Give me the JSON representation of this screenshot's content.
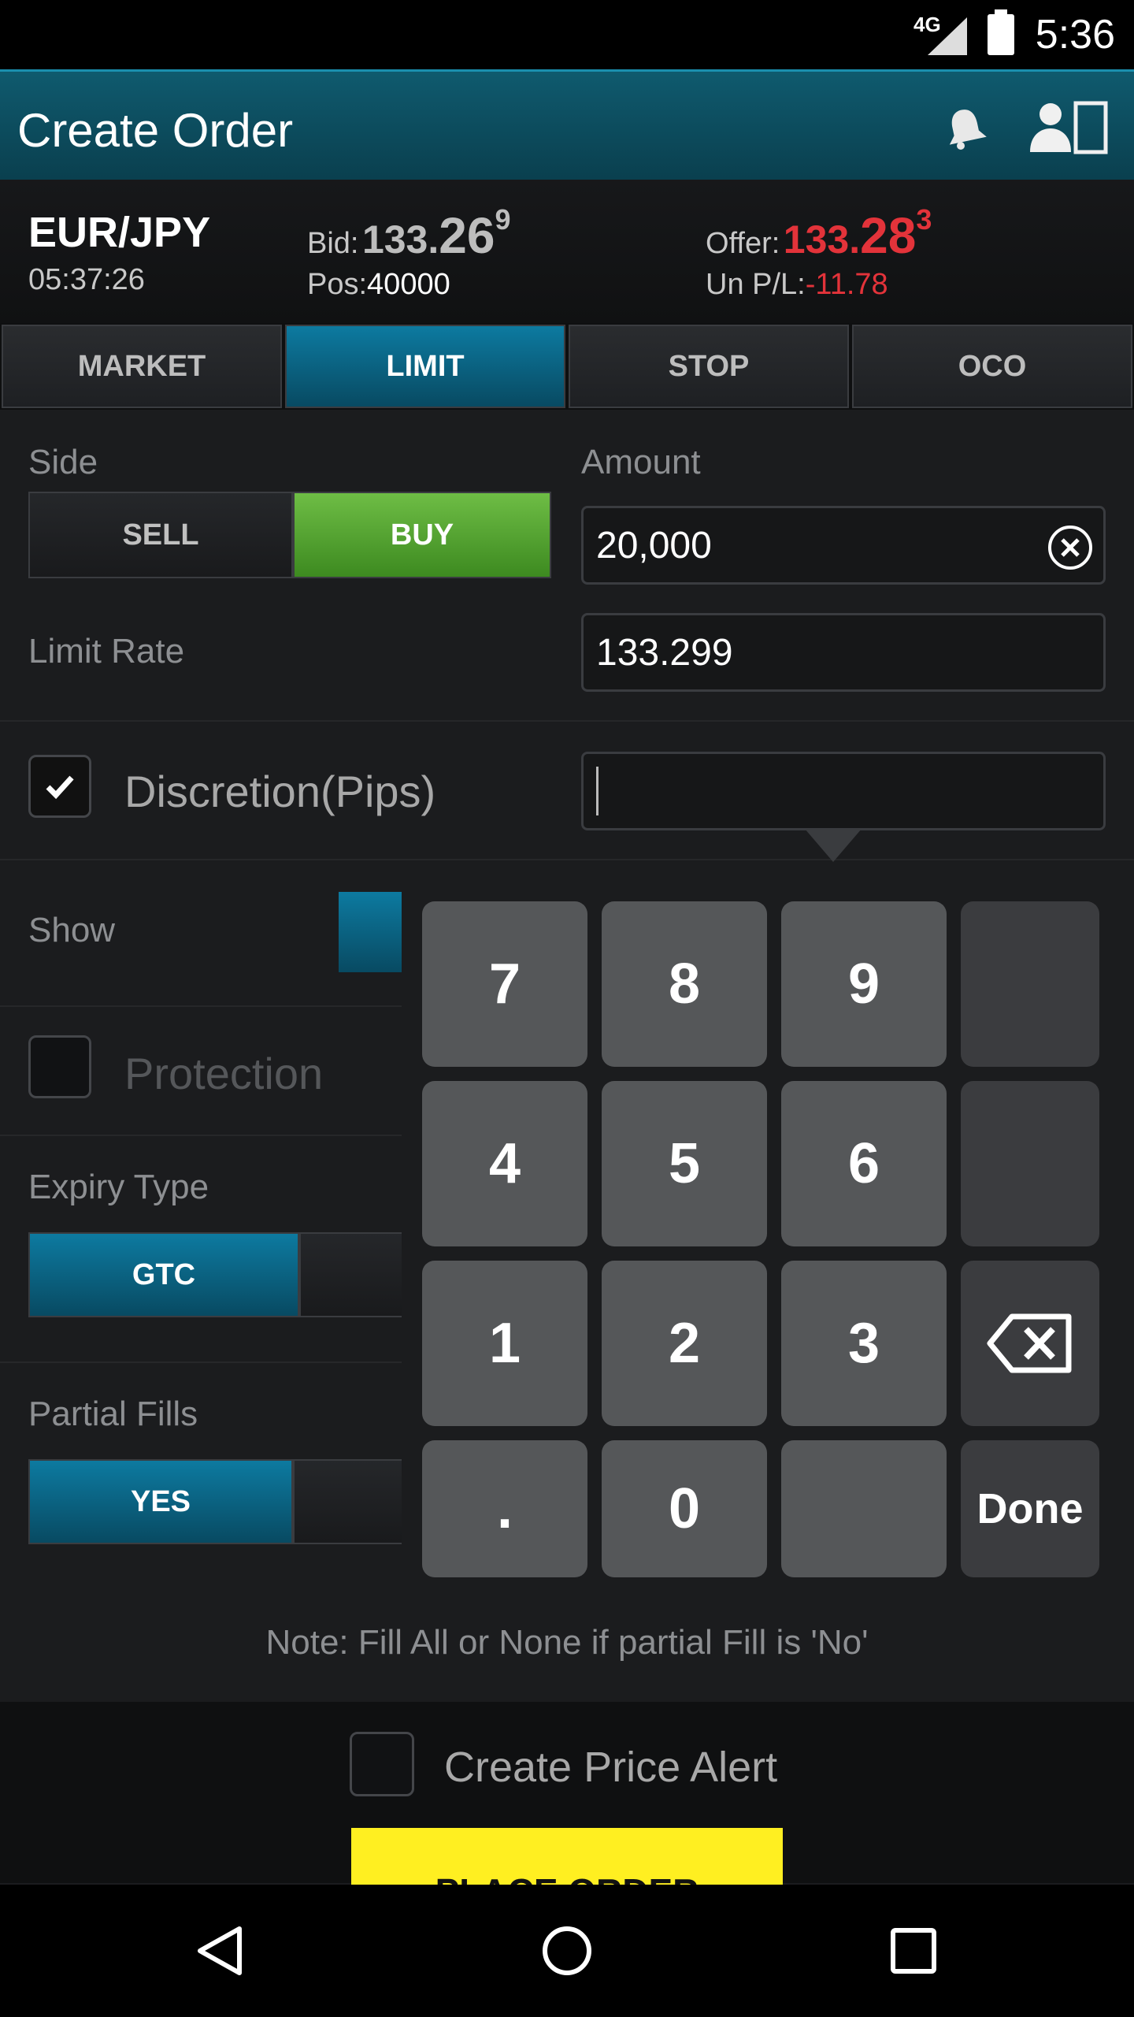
{
  "status_bar": {
    "network": "4G",
    "time": "5:36"
  },
  "app_bar": {
    "title": "Create Order"
  },
  "quote": {
    "pair": "EUR/JPY",
    "time": "05:37:26",
    "bid_label": "Bid:",
    "bid_prefix": "133.",
    "bid_big": "26",
    "bid_sup": "9",
    "offer_label": "Offer:",
    "offer_prefix": "133.",
    "offer_big": "28",
    "offer_sup": "3",
    "pos_label": "Pos:",
    "pos_value": "40000",
    "pl_label": "Un P/L:",
    "pl_value": "-11.78"
  },
  "order_tabs": [
    {
      "label": "MARKET",
      "active": false
    },
    {
      "label": "LIMIT",
      "active": true
    },
    {
      "label": "STOP",
      "active": false
    },
    {
      "label": "OCO",
      "active": false
    }
  ],
  "form": {
    "side_label": "Side",
    "sell_label": "SELL",
    "buy_label": "BUY",
    "amount_label": "Amount",
    "amount_value": "20,000",
    "limit_rate_label": "Limit Rate",
    "limit_rate_value": "133.299",
    "discretion_label": "Discretion(Pips)",
    "discretion_checked": true,
    "discretion_value": "",
    "show_label": "Show",
    "protection_label": "Protection",
    "expiry_label": "Expiry Type",
    "expiry_selected": "GTC",
    "partial_label": "Partial Fills",
    "partial_selected": "YES"
  },
  "keypad": {
    "keys": [
      "7",
      "8",
      "9",
      "4",
      "5",
      "6",
      "1",
      "2",
      "3",
      ".",
      "0",
      "Done"
    ]
  },
  "note": "Note: Fill All or None if partial Fill is 'No'",
  "price_alert_label": "Create Price Alert",
  "place_order_label": "PLACE ORDER"
}
